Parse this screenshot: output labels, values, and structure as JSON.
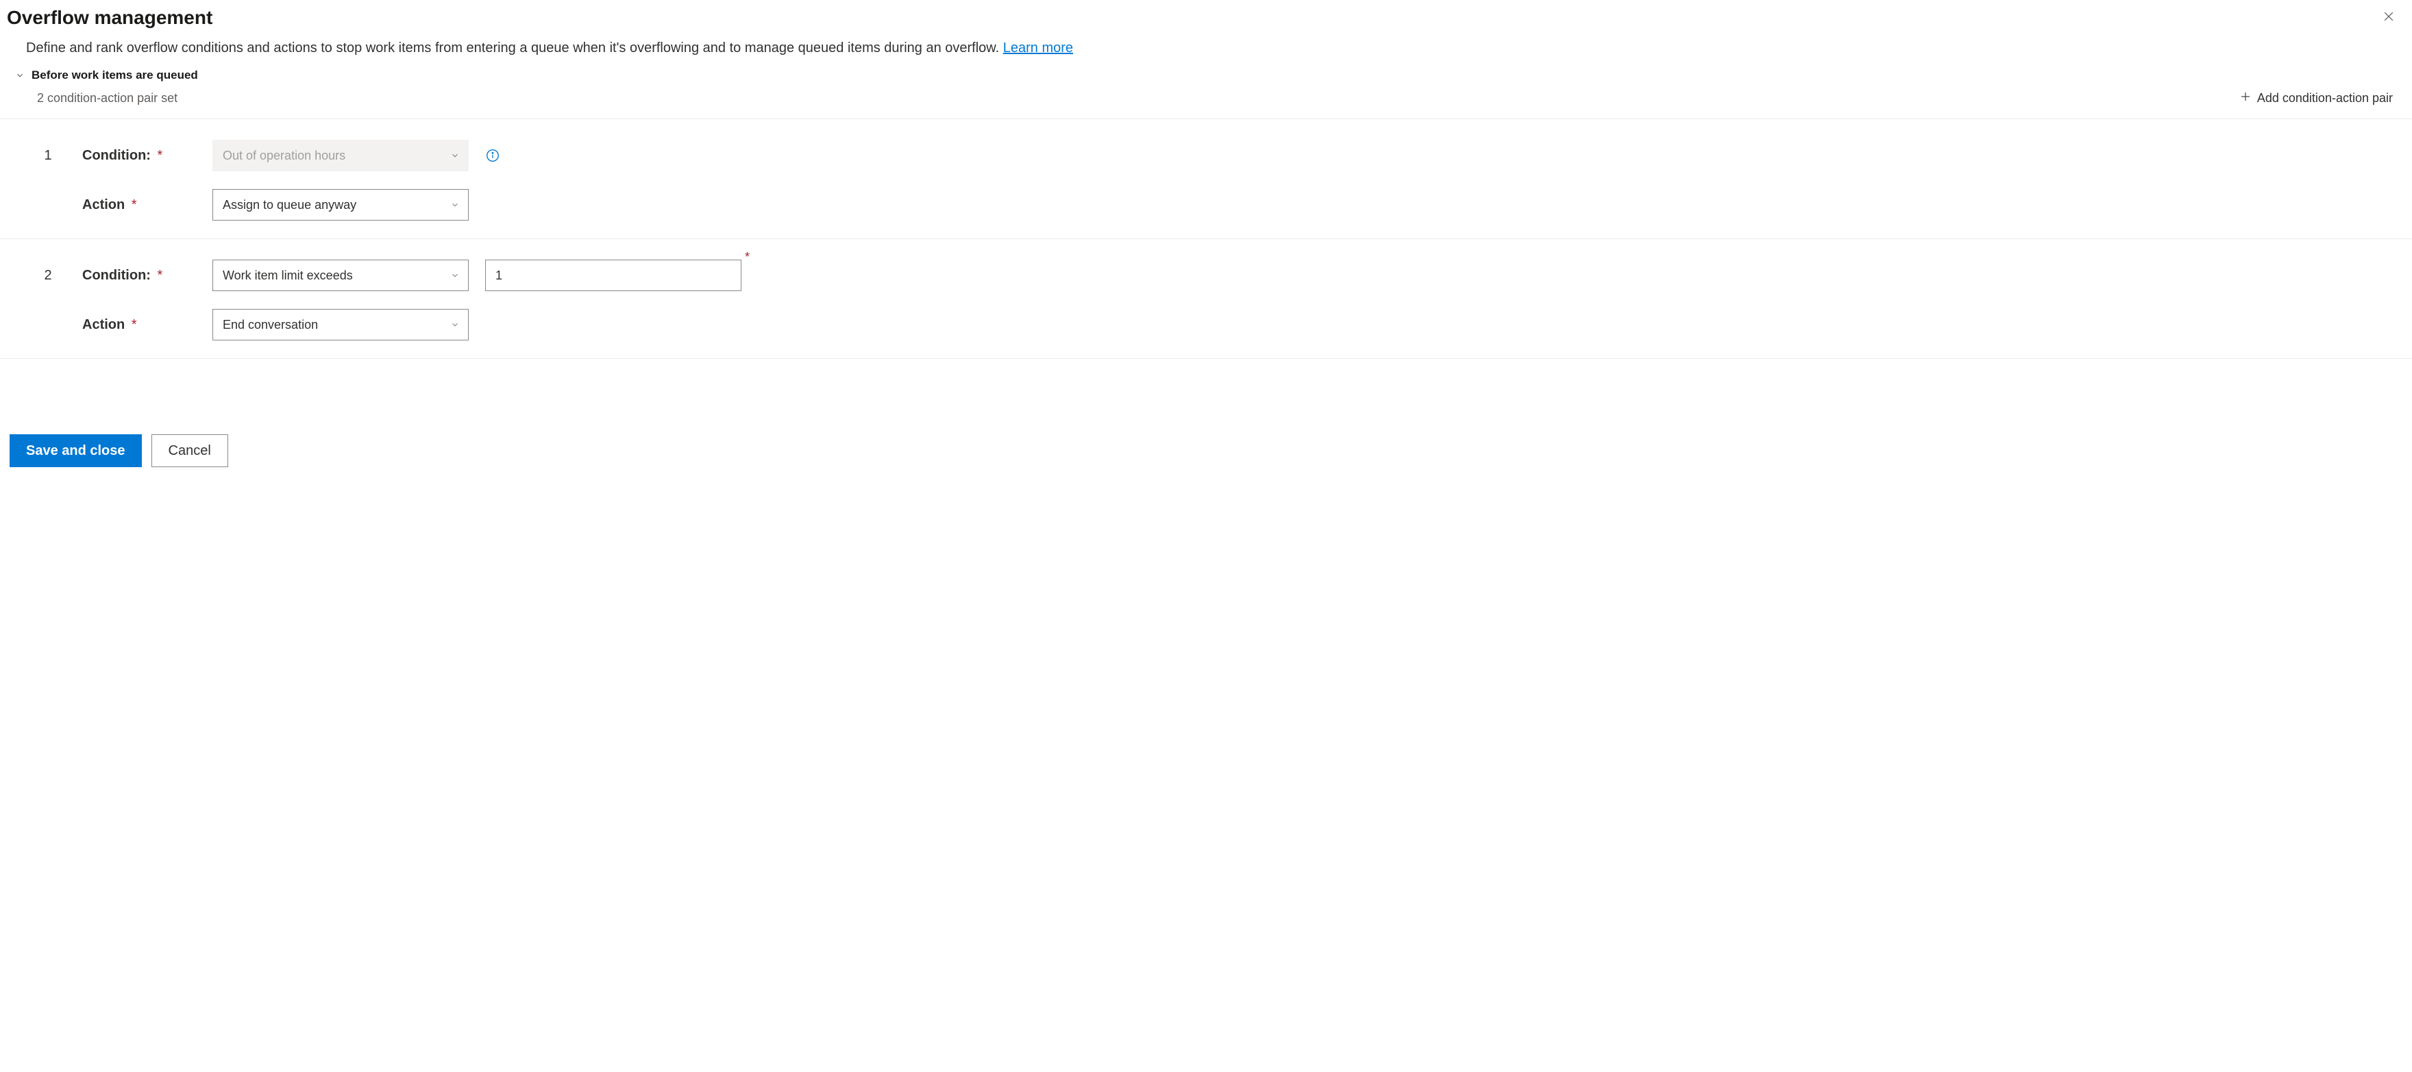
{
  "header": {
    "title": "Overflow management"
  },
  "description": {
    "text": "Define and rank overflow conditions and actions to stop work items from entering a queue when it's overflowing and to manage queued items during an overflow. ",
    "link_text": "Learn more"
  },
  "section": {
    "title": "Before work items are queued",
    "subtitle": "2 condition-action pair set",
    "add_button": "Add condition-action pair"
  },
  "labels": {
    "condition": "Condition:",
    "action": "Action"
  },
  "pairs": [
    {
      "index": "1",
      "condition_value": "Out of operation hours",
      "condition_disabled": true,
      "show_info": true,
      "action_value": "Assign to queue anyway",
      "numeric_value": null
    },
    {
      "index": "2",
      "condition_value": "Work item limit exceeds",
      "condition_disabled": false,
      "show_info": false,
      "action_value": "End conversation",
      "numeric_value": "1"
    }
  ],
  "footer": {
    "save": "Save and close",
    "cancel": "Cancel"
  }
}
